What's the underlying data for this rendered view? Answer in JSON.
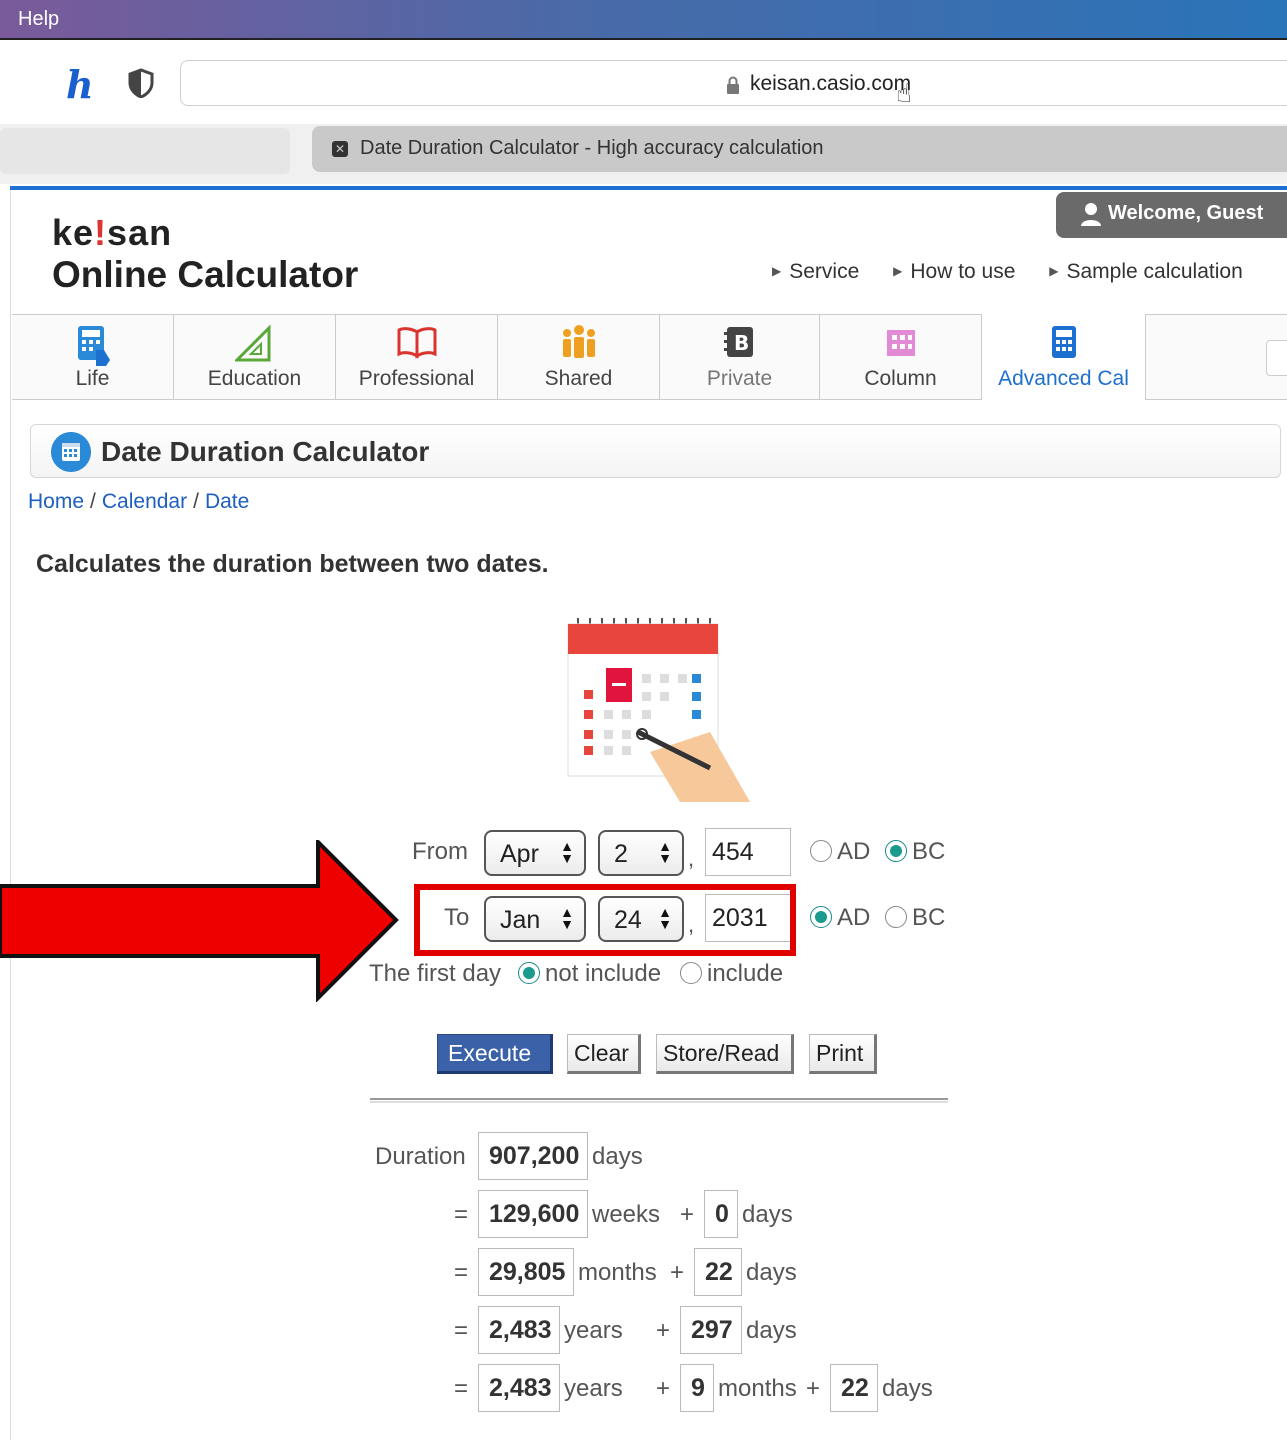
{
  "menubar": {
    "help": "Help"
  },
  "browser": {
    "url": "keisan.casio.com",
    "tab_title": "Date Duration Calculator - High accuracy calculation"
  },
  "site": {
    "logo_line1_a": "ke",
    "logo_line1_b": "!",
    "logo_line1_c": "san",
    "logo_line2": "Online Calculator",
    "welcome": "Welcome, Guest",
    "nav": [
      "Service",
      "How to use",
      "Sample calculation"
    ],
    "categories": [
      {
        "label": "Life",
        "icon": "calculator-hand-icon"
      },
      {
        "label": "Education",
        "icon": "triangle-ruler-icon"
      },
      {
        "label": "Professional",
        "icon": "open-book-icon"
      },
      {
        "label": "Shared",
        "icon": "people-icon"
      },
      {
        "label": "Private",
        "icon": "notebook-icon"
      },
      {
        "label": "Column",
        "icon": "building-icon"
      },
      {
        "label": "Advanced Cal",
        "icon": "calculator-icon"
      }
    ]
  },
  "page": {
    "title": "Date Duration Calculator",
    "breadcrumb": [
      "Home",
      "Calendar",
      "Date"
    ],
    "description": "Calculates the duration between two dates."
  },
  "form": {
    "from_label": "From",
    "from_month": "Apr",
    "from_day": "2",
    "from_year": "454",
    "from_era_selected": "BC",
    "to_label": "To",
    "to_month": "Jan",
    "to_day": "24",
    "to_year": "2031",
    "to_era_selected": "AD",
    "comma": ",",
    "ad": "AD",
    "bc": "BC",
    "first_day_label": "The first day",
    "first_day_not_include": "not include",
    "first_day_include": "include",
    "first_day_selected": "not include"
  },
  "buttons": {
    "execute": "Execute",
    "clear": "Clear",
    "store": "Store/Read",
    "print": "Print"
  },
  "result": {
    "duration_label": "Duration",
    "eq": "=",
    "plus": "+",
    "days_unit": "days",
    "weeks_unit": "weeks",
    "months_unit": "months",
    "years_unit": "years",
    "total_days": "907,200",
    "weeks": "129,600",
    "weeks_days": "0",
    "months": "29,805",
    "months_days": "22",
    "years_a": "2,483",
    "years_a_days": "297",
    "years_b": "2,483",
    "years_b_months": "9",
    "years_b_days": "22"
  },
  "colors": {
    "accent": "#1d6fd0",
    "execute": "#3b61a8",
    "highlight": "#e00000"
  }
}
